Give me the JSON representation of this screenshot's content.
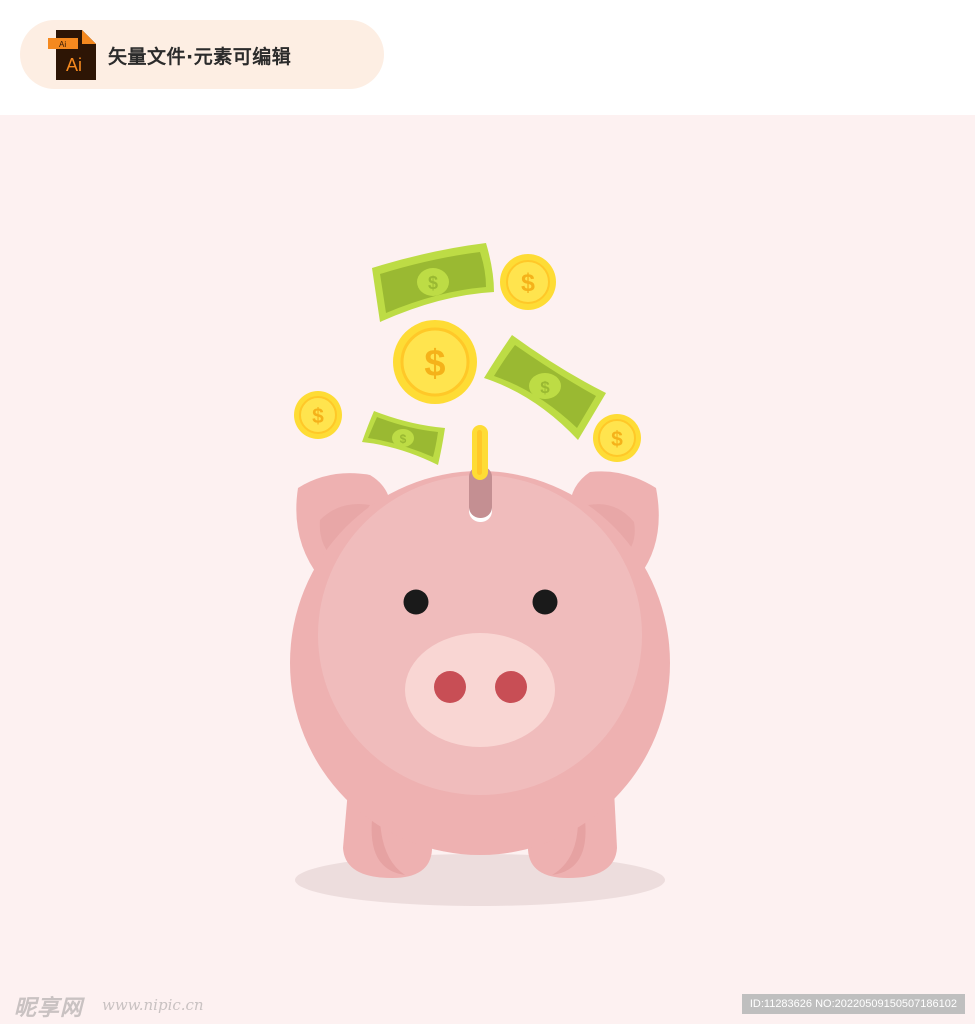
{
  "header": {
    "file_icon_label": "Ai",
    "file_icon_tag": "Ai",
    "title": "矢量文件·元素可编辑"
  },
  "illustration": {
    "subject": "piggy-bank",
    "coin_symbol": "$",
    "colors": {
      "background": "#fdf1f1",
      "pig_body": "#eeb1b1",
      "pig_face": "#f0bcbc",
      "snout": "#f9d6d3",
      "nostril": "#c84e55",
      "eye": "#1a1a1a",
      "coin": "#fedc35",
      "coin_inner": "#ffc828",
      "bill": "#9ab932",
      "bill_border": "#bddc45"
    }
  },
  "watermark": {
    "logo": "昵享网",
    "url": "www.nipic.cn",
    "id_text": "ID:11283626 NO:20220509150507186102"
  }
}
